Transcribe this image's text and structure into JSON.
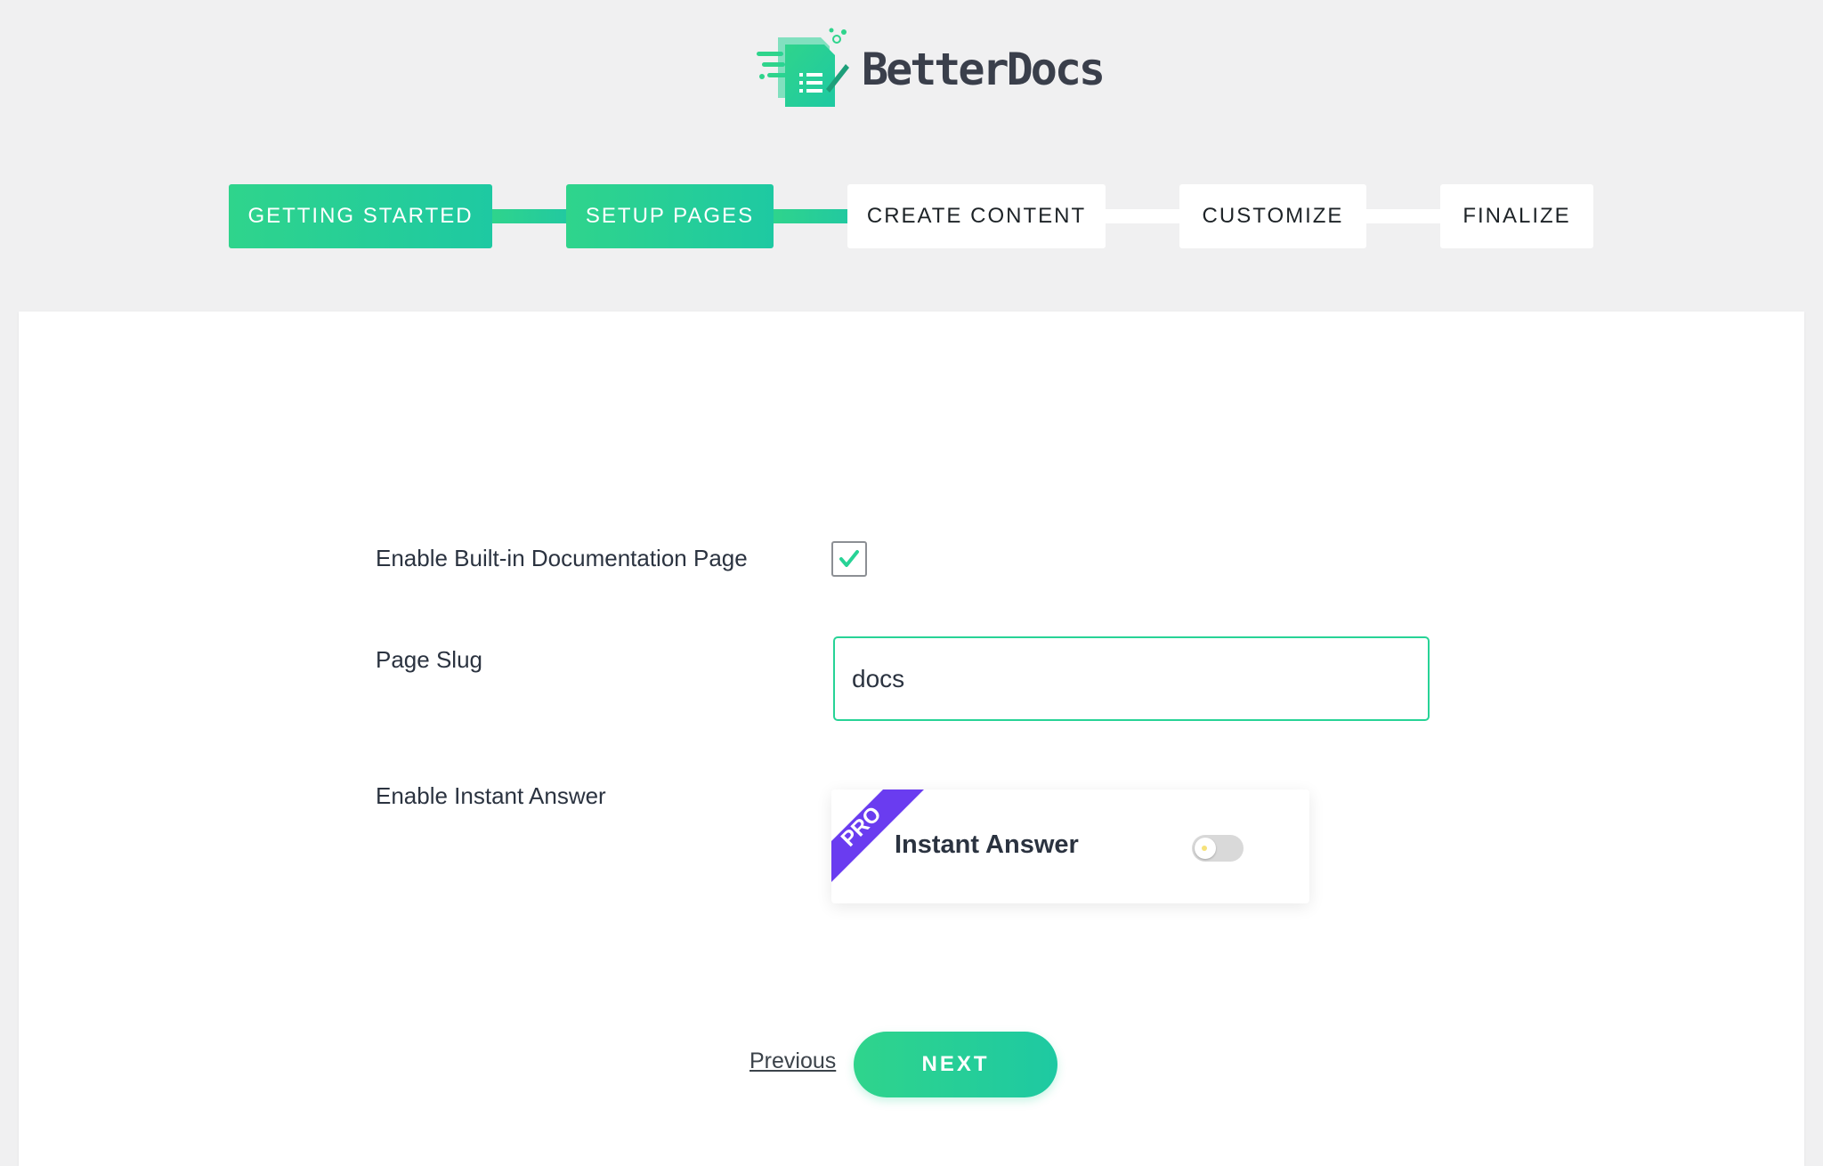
{
  "brand": {
    "name": "BetterDocs",
    "logo_icon": "betterdocs-logo-icon",
    "colors": {
      "accent_start": "#2fd48c",
      "accent_end": "#1ec9a2",
      "pro_badge": "#6a3cf0",
      "background": "#f0f0f1"
    }
  },
  "stepper": {
    "steps": [
      {
        "label": "GETTING STARTED",
        "state": "complete"
      },
      {
        "label": "SETUP PAGES",
        "state": "active"
      },
      {
        "label": "CREATE CONTENT",
        "state": "pending"
      },
      {
        "label": "CUSTOMIZE",
        "state": "pending"
      },
      {
        "label": "FINALIZE",
        "state": "pending"
      }
    ]
  },
  "form": {
    "builtin_docs": {
      "label": "Enable Built-in Documentation Page",
      "checked": true
    },
    "page_slug": {
      "label": "Page Slug",
      "value": "docs",
      "placeholder": ""
    },
    "instant_answer": {
      "label": "Enable Instant Answer",
      "card_title": "Instant Answer",
      "badge": "PRO",
      "enabled": false
    }
  },
  "nav": {
    "previous_label": "Previous",
    "next_label": "NEXT"
  }
}
